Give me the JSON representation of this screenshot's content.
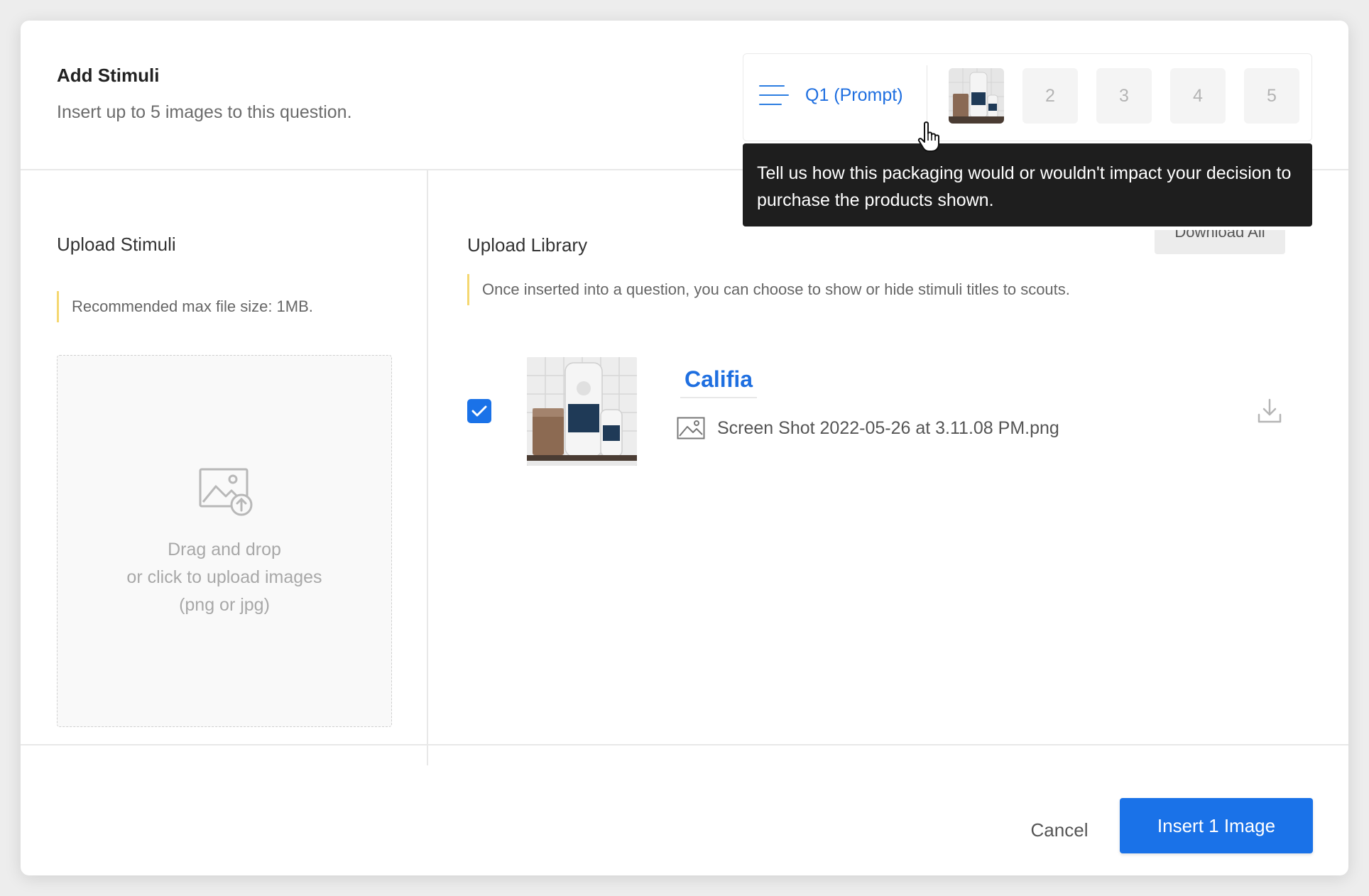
{
  "dialog": {
    "title": "Add Stimuli",
    "subtitle": "Insert up to 5 images to this question."
  },
  "question_nav": {
    "icon": "list-icon",
    "label": "Q1 (Prompt)",
    "slots": [
      "",
      "2",
      "3",
      "4",
      "5"
    ],
    "tooltip": "Tell us how this packaging would or wouldn't impact your decision to purchase the products shown."
  },
  "upload_panel": {
    "title": "Upload Stimuli",
    "note": "Recommended max file size: 1MB.",
    "dropzone_icon": "image-upload-icon",
    "dropzone_line1": "Drag and drop",
    "dropzone_line2": "or click to upload images",
    "dropzone_line3": "(png or jpg)"
  },
  "library_panel": {
    "title": "Upload Library",
    "download_all_label": "Download All",
    "note": "Once inserted into a question, you can choose to show or hide stimuli titles to scouts.",
    "items": [
      {
        "checked": true,
        "title": "Califia",
        "file_name": "Screen Shot 2022-05-26 at 3.11.08 PM.png",
        "file_icon": "image-file-icon",
        "action_icon": "download-icon"
      }
    ]
  },
  "footer": {
    "cancel_label": "Cancel",
    "insert_label": "Insert 1 Image"
  },
  "colors": {
    "accent": "#1a72e8",
    "link": "#1f6fe0",
    "tooltip_bg": "#1e1e1e",
    "note_border": "#f5d770"
  }
}
